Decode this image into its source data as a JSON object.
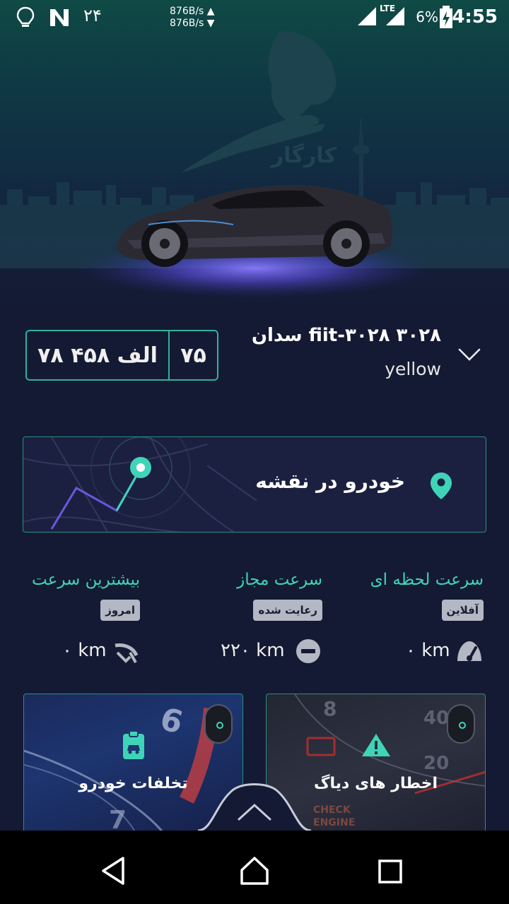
{
  "status_bar": {
    "time": "4:55",
    "battery": "6%",
    "network": "LTE",
    "net_up": "876B/s",
    "net_down": "876B/s",
    "left_num": "۲۴"
  },
  "hero": {
    "logo_text": "کارگار"
  },
  "vehicle": {
    "title": "سدان  fiit-۳۰۲۸ ۳۰۲۸",
    "color": "yellow",
    "plate_main": "۷۸ الف ۴۵۸",
    "plate_region": "۷۵"
  },
  "map_card": {
    "label": "خودرو در نقشه"
  },
  "stats": [
    {
      "title": "سرعت لحظه ای",
      "badge": "آفلاین",
      "value": "۰ km",
      "icon": "speedometer-icon"
    },
    {
      "title": "سرعت مجاز",
      "badge": "رعایت شده",
      "value": "۲۲۰ km",
      "icon": "minus-circle-icon"
    },
    {
      "title": "بیشترین سرعت",
      "badge": "امروز",
      "value": "۰ km",
      "icon": "top-speed-icon"
    }
  ],
  "cards": {
    "diag": {
      "label": "اخطار های دیاگ",
      "icon": "warning-icon"
    },
    "violations": {
      "label": "تخلفات خودرو",
      "icon": "clipboard-car-icon"
    }
  },
  "colors": {
    "accent": "#3fd4b8",
    "background": "#141a33",
    "border": "#2fb39a"
  }
}
